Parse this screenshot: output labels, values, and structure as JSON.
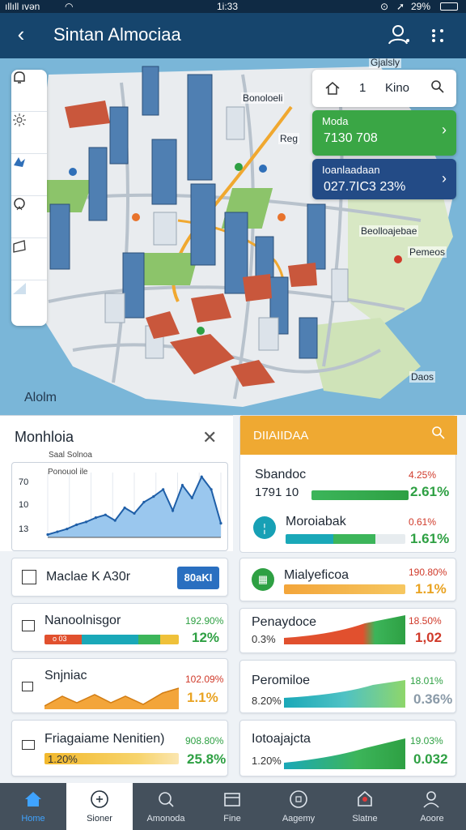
{
  "status": {
    "carrier": "ıllıll ıvən",
    "time": "1i:33",
    "battery": "29%"
  },
  "header": {
    "title": "Sintan Almociaa"
  },
  "map": {
    "search": {
      "count": "1",
      "text": "Kino"
    },
    "card_green": {
      "line1": "Moda",
      "line2": "7130 708"
    },
    "card_blue": {
      "line1": "Ioanlaadaan",
      "line2": "027.7IC3 23%"
    },
    "labels": {
      "top": "Gjalsly",
      "building": "Bonoloeli",
      "reg": "Reg",
      "right1": "Beolloajebae",
      "right2": "Pemeos",
      "bottom": "Daos"
    },
    "watermark": "Alolm"
  },
  "left_panel": {
    "title": "Monhloia",
    "chart_title": "Saal Solnoa",
    "chart_legend": "Ponouol ile",
    "tick_labels": [
      "70",
      "10",
      "13"
    ]
  },
  "chart_data": {
    "type": "area",
    "x": [
      1,
      2,
      3,
      4,
      5,
      6,
      7,
      8,
      9,
      10,
      11,
      12,
      13,
      14,
      15,
      16,
      17,
      18,
      19
    ],
    "y": [
      2,
      4,
      6,
      9,
      11,
      14,
      16,
      12,
      21,
      17,
      25,
      29,
      34,
      19,
      37,
      28,
      43,
      34,
      10
    ],
    "title": "",
    "color": "#9ac7ee",
    "line_color": "#1f5fa8"
  },
  "right_panel": {
    "header": "DIIAIIDAA",
    "row1": {
      "title": "Sbandoc",
      "sub": "1791 10",
      "pct_top": "4.25%",
      "pct_big": "2.61%"
    },
    "row2": {
      "title": "Moroiabak",
      "pct_top": "0.61%",
      "pct_big": "1.61%"
    }
  },
  "left_cards": [
    {
      "title": "Maclae K A30r",
      "button": "80aKI"
    },
    {
      "title": "Nanoolnisgor",
      "pct_top": "192.90%",
      "pct_big": "12%",
      "sub": "o 03"
    },
    {
      "title": "Snjniac",
      "pct_top": "102.09%",
      "pct_big": "1.1%"
    },
    {
      "title": "Friagaiame Nenitien)",
      "pct_top": "908.80%",
      "pct_big": "25.8%",
      "sub": "1.20%"
    }
  ],
  "right_cards": [
    {
      "title": "Mialyeficoa",
      "pct_top": "190.80%",
      "pct_big": "1.1%"
    },
    {
      "title": "Penaydoce",
      "pct_top": "18.50%",
      "pct_big": "1,02",
      "sub": "0.3%"
    },
    {
      "title": "Peromiloe",
      "pct_top": "18.01%",
      "pct_big": "0.36%",
      "sub": "8.20%"
    },
    {
      "title": "Iotoajajcta",
      "pct_top": "19.03%",
      "pct_big": "0.032",
      "sub": "1.20%"
    }
  ],
  "bottom_nav": [
    {
      "label": "Home",
      "icon": "home-icon"
    },
    {
      "label": "Sioner",
      "icon": "compass-icon"
    },
    {
      "label": "Amonoda",
      "icon": "search-icon"
    },
    {
      "label": "Fine",
      "icon": "folder-icon"
    },
    {
      "label": "Aagemy",
      "icon": "agency-icon"
    },
    {
      "label": "Slatne",
      "icon": "location-icon"
    },
    {
      "label": "Aoore",
      "icon": "profile-icon"
    }
  ]
}
